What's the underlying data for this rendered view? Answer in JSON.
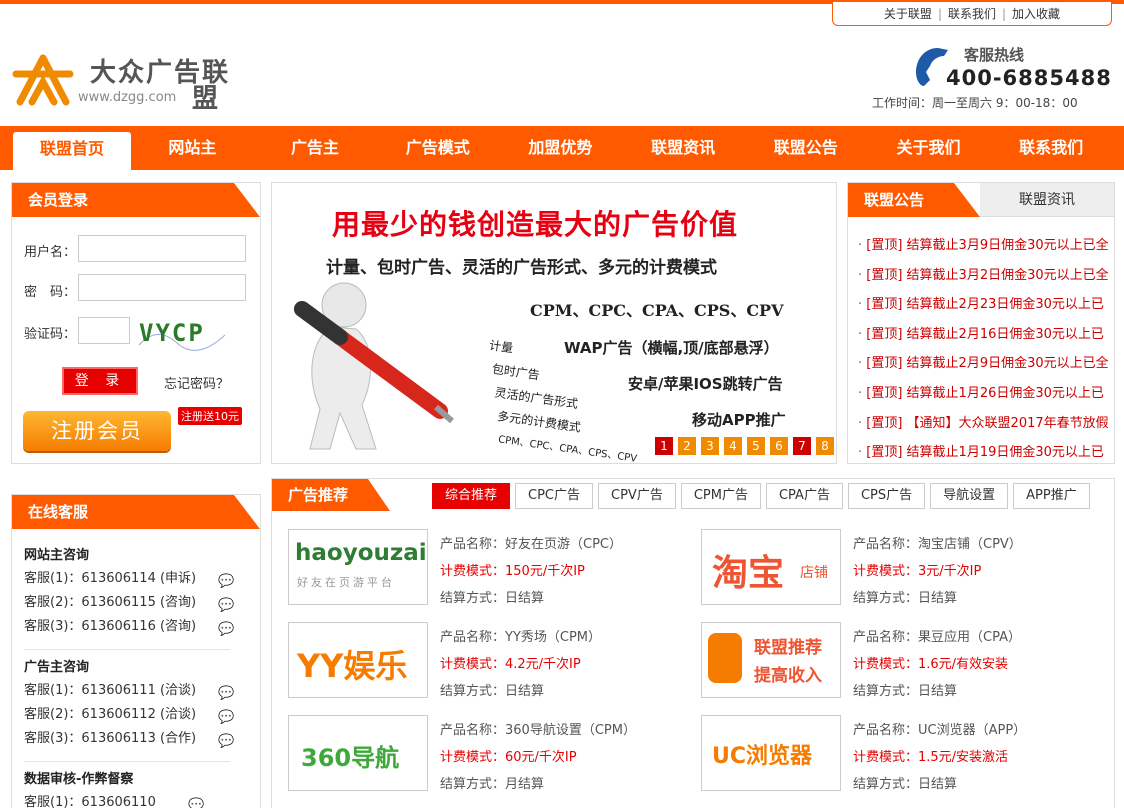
{
  "toplinks": [
    "关于联盟",
    "联系我们",
    "加入收藏"
  ],
  "logo": {
    "name": "大众广告联",
    "name_tail": "盟",
    "url": "www.dzgg.com"
  },
  "hotline": {
    "title": "客服热线",
    "number": "400-6885488",
    "hours": "工作时间：周一至周六 9：00-18：00"
  },
  "nav": [
    "联盟首页",
    "网站主",
    "广告主",
    "广告模式",
    "加盟优势",
    "联盟资讯",
    "联盟公告",
    "关于我们",
    "联系我们"
  ],
  "login": {
    "title": "会员登录",
    "username_label": "用户名：",
    "password_label": "密　码：",
    "captcha_label": "验证码：",
    "captcha_text": "VYCP",
    "login_button": "登 录",
    "forgot": "忘记密码？",
    "register_button": "注册会员",
    "register_badge": "注册送10元"
  },
  "banner": {
    "title": "用最少的钱创造最大的广告价值",
    "subtitle": "计量、包时广告、灵活的广告形式、多元的计费模式",
    "lines": [
      "CPM、CPC、CPA、CPS、CPV",
      "WAP广告（横幅,顶/底部悬浮）",
      "安卓/苹果IOS跳转广告",
      "移动APP推广"
    ],
    "checks": [
      "计量",
      "包时广告",
      "灵活的广告形式",
      "多元的计费模式",
      "CPM、CPC、CPA、CPS、CPV"
    ],
    "pages": [
      "1",
      "2",
      "3",
      "4",
      "5",
      "6",
      "7",
      "8"
    ]
  },
  "notices": {
    "tab_active": "联盟公告",
    "tab_other": "联盟资讯",
    "items": [
      "[置顶] 结算截止3月9日佣金30元以上已全",
      "[置顶] 结算截止3月2日佣金30元以上已全",
      "[置顶] 结算截止2月23日佣金30元以上已",
      "[置顶] 结算截止2月16日佣金30元以上已",
      "[置顶] 结算截止2月9日佣金30元以上已全",
      "[置顶] 结算截止1月26日佣金30元以上已",
      "[置顶] 【通知】大众联盟2017年春节放假",
      "[置顶] 结算截止1月19日佣金30元以上已"
    ]
  },
  "service": {
    "title": "在线客服",
    "groups": [
      {
        "head": "网站主咨询",
        "rows": [
          "客服(1)：613606114 (申诉)",
          "客服(2)：613606115 (咨询)",
          "客服(3)：613606116 (咨询)"
        ]
      },
      {
        "head": "广告主咨询",
        "rows": [
          "客服(1)：613606111 (洽谈)",
          "客服(2)：613606112 (洽谈)",
          "客服(3)：613606113 (合作)"
        ]
      },
      {
        "head": "数据审核-作弊督察",
        "rows": [
          "客服(1)：613606110"
        ]
      }
    ]
  },
  "ads": {
    "title": "广告推荐",
    "tabs": [
      "综合推荐",
      "CPC广告",
      "CPV广告",
      "CPM广告",
      "CPA广告",
      "CPS广告",
      "导航设置",
      "APP推广"
    ],
    "items": [
      {
        "logo": "haoyouzai",
        "logo_sub": "好友在页游平台",
        "name": "产品名称：好友在页游（CPC）",
        "price": "计费模式：150元/千次IP",
        "settle": "结算方式：日结算"
      },
      {
        "logo": "淘宝",
        "logo_sub": "店铺",
        "name": "产品名称：淘宝店铺（CPV）",
        "price": "计费模式：3元/千次IP",
        "settle": "结算方式：日结算"
      },
      {
        "logo": "YY娱乐",
        "logo_sub": "",
        "name": "产品名称：YY秀场（CPM）",
        "price": "计费模式：4.2元/千次IP",
        "settle": "结算方式：日结算"
      },
      {
        "logo": "联盟推荐",
        "logo_sub": "提高收入",
        "name": "产品名称：果豆应用（CPA）",
        "price": "计费模式：1.6元/有效安装",
        "settle": "结算方式：日结算"
      },
      {
        "logo": "360导航",
        "logo_sub": "",
        "name": "产品名称：360导航设置（CPM）",
        "price": "计费模式：60元/千次IP",
        "settle": "结算方式：月结算"
      },
      {
        "logo": "UC浏览器",
        "logo_sub": "",
        "name": "产品名称：UC浏览器（APP）",
        "price": "计费模式：1.5元/安装激活",
        "settle": "结算方式：日结算"
      }
    ]
  }
}
